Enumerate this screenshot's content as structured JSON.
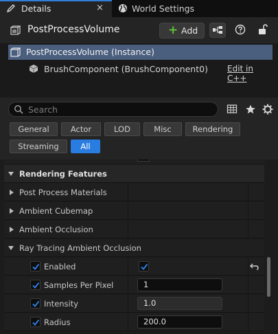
{
  "tabs": {
    "details": "Details",
    "world_settings": "World Settings",
    "close_glyph": "×"
  },
  "header": {
    "title": "PostProcessVolume",
    "add_label": "Add",
    "add_glyph": "+"
  },
  "components": {
    "root": "PostProcessVolume (Instance)",
    "child": "BrushComponent (BrushComponent0)",
    "edit_link": "Edit in C++"
  },
  "search": {
    "placeholder": "Search"
  },
  "filters": [
    "General",
    "Actor",
    "LOD",
    "Misc",
    "Rendering",
    "Streaming",
    "All"
  ],
  "active_filter": "All",
  "properties": {
    "section": "Rendering Features",
    "categories": [
      "Post Process Materials",
      "Ambient Cubemap",
      "Ambient Occlusion",
      "Ray Tracing Ambient Occlusion"
    ],
    "rtao": {
      "enabled": {
        "label": "Enabled",
        "override": true,
        "value": true
      },
      "samples": {
        "label": "Samples Per Pixel",
        "override": true,
        "value": "1"
      },
      "intensity": {
        "label": "Intensity",
        "override": true,
        "value": "1.0"
      },
      "radius": {
        "label": "Radius",
        "override": true,
        "value": "200.0"
      }
    }
  },
  "colors": {
    "accent": "#2a7de0",
    "selection": "#4a5e7e",
    "add_plus": "#5fbf3a"
  }
}
